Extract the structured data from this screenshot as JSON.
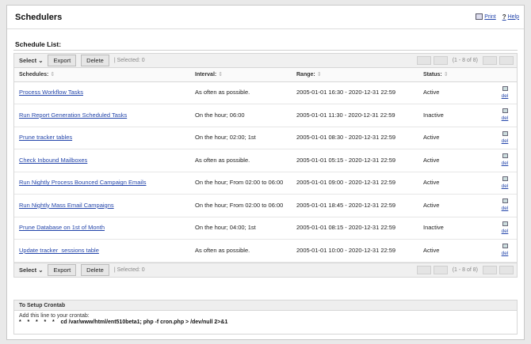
{
  "page": {
    "title": "Schedulers",
    "print_label": "Print",
    "help_label": "Help",
    "section_title": "Schedule List:"
  },
  "toolbar": {
    "select_label": "Select",
    "export_label": "Export",
    "delete_label": "Delete",
    "selected_text": "| Selected: 0",
    "page_count": "(1 - 8 of 8)"
  },
  "columns": {
    "name": "Schedules:",
    "interval": "Interval:",
    "range": "Range:",
    "status": "Status:"
  },
  "rows": [
    {
      "name": "Process Workflow Tasks",
      "interval": "As often as possible.",
      "range": "2005-01-01 16:30 - 2020-12-31 22:59",
      "status": "Active"
    },
    {
      "name": "Run Report Generation Scheduled Tasks",
      "interval": "On the hour; 06:00",
      "range": "2005-01-01 11:30 - 2020-12-31 22:59",
      "status": "Inactive"
    },
    {
      "name": "Prune tracker tables",
      "interval": "On the hour; 02:00; 1st",
      "range": "2005-01-01 08:30 - 2020-12-31 22:59",
      "status": "Active"
    },
    {
      "name": "Check Inbound Mailboxes",
      "interval": "As often as possible.",
      "range": "2005-01-01 05:15 - 2020-12-31 22:59",
      "status": "Active"
    },
    {
      "name": "Run Nightly Process Bounced Campaign Emails",
      "interval": "On the hour; From 02:00 to 06:00",
      "range": "2005-01-01 09:00 - 2020-12-31 22:59",
      "status": "Active"
    },
    {
      "name": "Run Nightly Mass Email Campaigns",
      "interval": "On the hour; From 02:00 to 06:00",
      "range": "2005-01-01 18:45 - 2020-12-31 22:59",
      "status": "Active"
    },
    {
      "name": "Prune Database on 1st of Month",
      "interval": "On the hour; 04:00; 1st",
      "range": "2005-01-01 08:15 - 2020-12-31 22:59",
      "status": "Inactive"
    },
    {
      "name": "Update tracker_sessions table",
      "interval": "As often as possible.",
      "range": "2005-01-01 10:00 - 2020-12-31 22:59",
      "status": "Active"
    }
  ],
  "row_action": {
    "delete_label": "del"
  },
  "crontab": {
    "title": "To Setup Crontab",
    "instruction": "Add this line to your crontab:",
    "command": "*    *    *    *    *    cd /var/www/html/ent510beta1; php -f cron.php > /dev/null 2>&1"
  }
}
